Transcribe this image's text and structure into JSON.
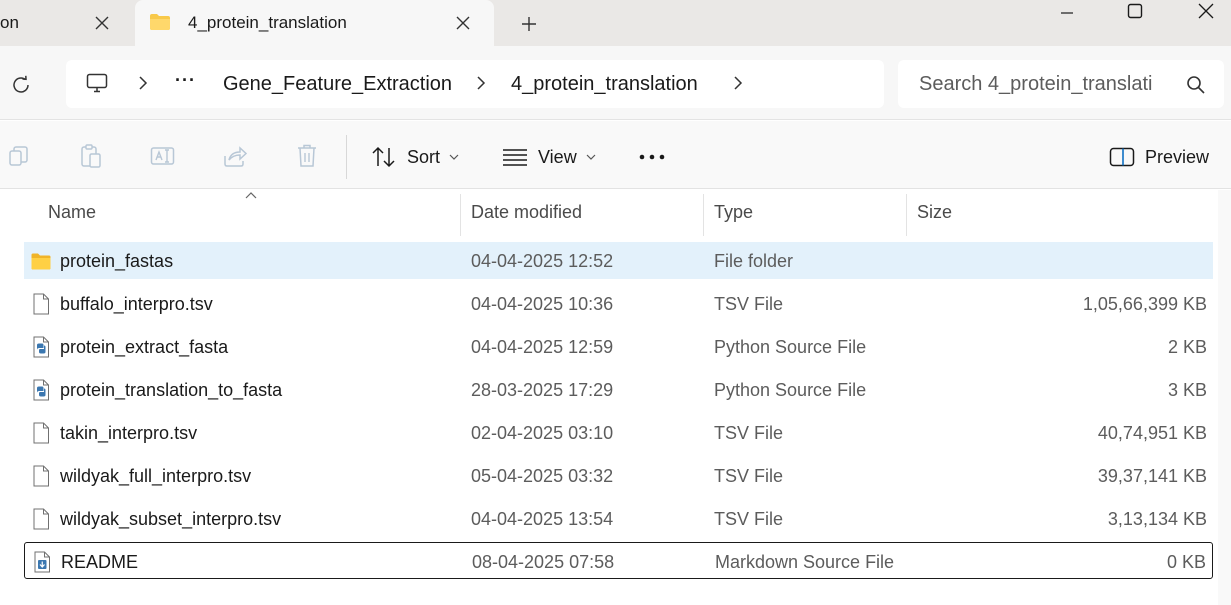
{
  "tabs": [
    {
      "label": "on",
      "active": false
    },
    {
      "label": "4_protein_translation",
      "active": true
    }
  ],
  "address": {
    "crumbs": [
      "Gene_Feature_Extraction",
      "4_protein_translation"
    ],
    "overflow": "···"
  },
  "search": {
    "placeholder": "Search 4_protein_translati"
  },
  "commands": {
    "sort_label": "Sort",
    "view_label": "View",
    "preview_label": "Preview"
  },
  "columns": {
    "name": "Name",
    "date": "Date modified",
    "type": "Type",
    "size": "Size"
  },
  "files": [
    {
      "name": "protein_fastas",
      "date": "04-04-2025 12:52",
      "type": "File folder",
      "size": "",
      "icon": "folder-icon"
    },
    {
      "name": "buffalo_interpro.tsv",
      "date": "04-04-2025 10:36",
      "type": "TSV File",
      "size": "1,05,66,399 KB",
      "icon": "file-icon"
    },
    {
      "name": "protein_extract_fasta",
      "date": "04-04-2025 12:59",
      "type": "Python Source File",
      "size": "2 KB",
      "icon": "python-file-icon"
    },
    {
      "name": "protein_translation_to_fasta",
      "date": "28-03-2025 17:29",
      "type": "Python Source File",
      "size": "3 KB",
      "icon": "python-file-icon"
    },
    {
      "name": "takin_interpro.tsv",
      "date": "02-04-2025 03:10",
      "type": "TSV File",
      "size": "40,74,951 KB",
      "icon": "file-icon"
    },
    {
      "name": "wildyak_full_interpro.tsv",
      "date": "05-04-2025 03:32",
      "type": "TSV File",
      "size": "39,37,141 KB",
      "icon": "file-icon"
    },
    {
      "name": "wildyak_subset_interpro.tsv",
      "date": "04-04-2025 13:54",
      "type": "TSV File",
      "size": "3,13,134 KB",
      "icon": "file-icon"
    },
    {
      "name": "README",
      "date": "08-04-2025 07:58",
      "type": "Markdown Source File",
      "size": "0 KB",
      "icon": "markdown-file-icon"
    }
  ],
  "colors": {
    "selected_row": "#e3f1fb",
    "folder": "#f8c94a",
    "accent": "#0067c0"
  }
}
